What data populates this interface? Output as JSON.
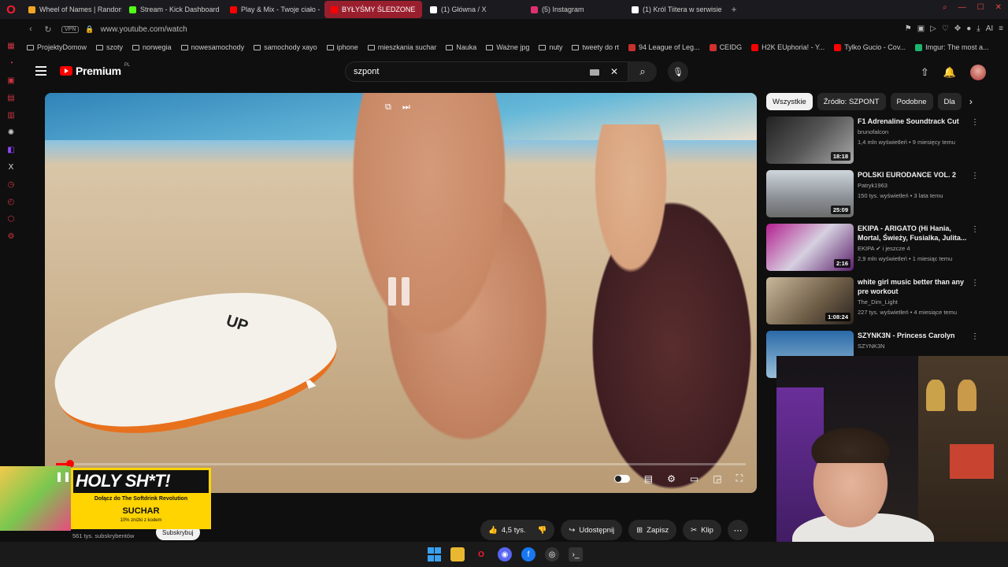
{
  "browser": {
    "tabs": [
      {
        "label": "Wheel of Names | Random",
        "color": "#f4a623"
      },
      {
        "label": "Stream - Kick Dashboard",
        "color": "#53fc18"
      },
      {
        "label": "Play & Mix - Twoje ciało -",
        "color": "#ff0000"
      },
      {
        "label": "BYŁYŚMY ŚLEDZONE",
        "color": "#ff0000",
        "active": true
      },
      {
        "label": "(1) Główna / X",
        "color": "#ffffff"
      },
      {
        "label": "(5) Instagram",
        "color": "#e1306c"
      },
      {
        "label": "(1) Król Tiitera w serwisie",
        "color": "#ffffff"
      }
    ],
    "new_tab": "+",
    "vpn": "VPN",
    "url": "www.youtube.com/watch",
    "bookmarks": [
      {
        "label": "ProjektyDomow",
        "type": "folder"
      },
      {
        "label": "szoty",
        "type": "folder"
      },
      {
        "label": "norwegia",
        "type": "folder"
      },
      {
        "label": "nowesamochody",
        "type": "folder"
      },
      {
        "label": "samochody xayo",
        "type": "folder"
      },
      {
        "label": "iphone",
        "type": "folder"
      },
      {
        "label": "mieszkania suchar",
        "type": "folder"
      },
      {
        "label": "Nauka",
        "type": "folder"
      },
      {
        "label": "Ważne jpg",
        "type": "folder"
      },
      {
        "label": "nuty",
        "type": "folder"
      },
      {
        "label": "tweety do rt",
        "type": "folder"
      },
      {
        "label": "94 League of Leg...",
        "type": "site",
        "color": "#c8302c"
      },
      {
        "label": "CEIDG",
        "type": "site",
        "color": "#d03030"
      },
      {
        "label": "H2K EUphoria! - Y...",
        "type": "site",
        "color": "#ff0000"
      },
      {
        "label": "Tylko Gucio - Cov...",
        "type": "site",
        "color": "#ff0000"
      },
      {
        "label": "Imgur: The most a...",
        "type": "site",
        "color": "#1bb76e"
      }
    ]
  },
  "youtube": {
    "logo": "Premium",
    "logo_region": "PL",
    "search_value": "szpont",
    "player": {
      "board_text": "UP",
      "progress": 0.02
    },
    "chips": [
      {
        "label": "Wszystkie",
        "active": true
      },
      {
        "label": "Źródło: SZPONT"
      },
      {
        "label": "Podobne"
      },
      {
        "label": "Dla"
      }
    ],
    "recs": [
      {
        "title": "F1 Adrenaline Soundtrack Cut",
        "channel": "brunofalcon",
        "meta": "1,4 mln wyświetleń • 9 miesięcy temu",
        "duration": "18:18",
        "thumb": "linear-gradient(135deg,#222,#555 50%,#aaa)"
      },
      {
        "title": "POLSKI EURODANCE VOL. 2",
        "channel": "Patryk1963",
        "meta": "150 tys. wyświetleń • 3 lata temu",
        "duration": "25:09",
        "thumb": "linear-gradient(180deg,#cfd6dc,#8a8f95 60%,#6b6b6b)"
      },
      {
        "title": "EKIPA - ARIGATO (Hi Hania, Mortal, Świeży, Fusialka, Julita...",
        "channel": "EKIPA ✔ i jeszcze 4",
        "meta": "2,9 mln wyświetleń • 1 miesiąc temu",
        "duration": "2:16",
        "thumb": "linear-gradient(135deg,#b3208f,#d6d0e0 50%,#5a1f6a)"
      },
      {
        "title": "white girl music better than any pre workout",
        "channel": "The_Dim_Light",
        "meta": "227 tys. wyświetleń • 4 miesiące temu",
        "duration": "1:08:24",
        "thumb": "linear-gradient(135deg,#c9b89a,#6b5a44 60%,#2a2420)"
      },
      {
        "title": "SZYNK3N - Princess Carolyn",
        "channel": "SZYNK3N",
        "meta": "",
        "duration": "",
        "thumb": "linear-gradient(180deg,#2a6aa8,#9ac0d8)"
      }
    ],
    "actions": {
      "likes": "4,5 tys.",
      "share": "Udostępnij",
      "save": "Zapisz",
      "clip": "Klip"
    },
    "subscribers": "561 tys. subskrybentów",
    "subscribe": "Subskrybuj"
  },
  "promo": {
    "headline": "HOLY SH*T!",
    "line1": "Dołącz do The Softdrink Revolution",
    "line2": "SUCHAR",
    "line3": "10% zniżki z kodem"
  },
  "icons": {
    "search": "search-icon",
    "mic": "microphone-icon",
    "upload": "upload-icon",
    "bell": "bell-icon"
  }
}
